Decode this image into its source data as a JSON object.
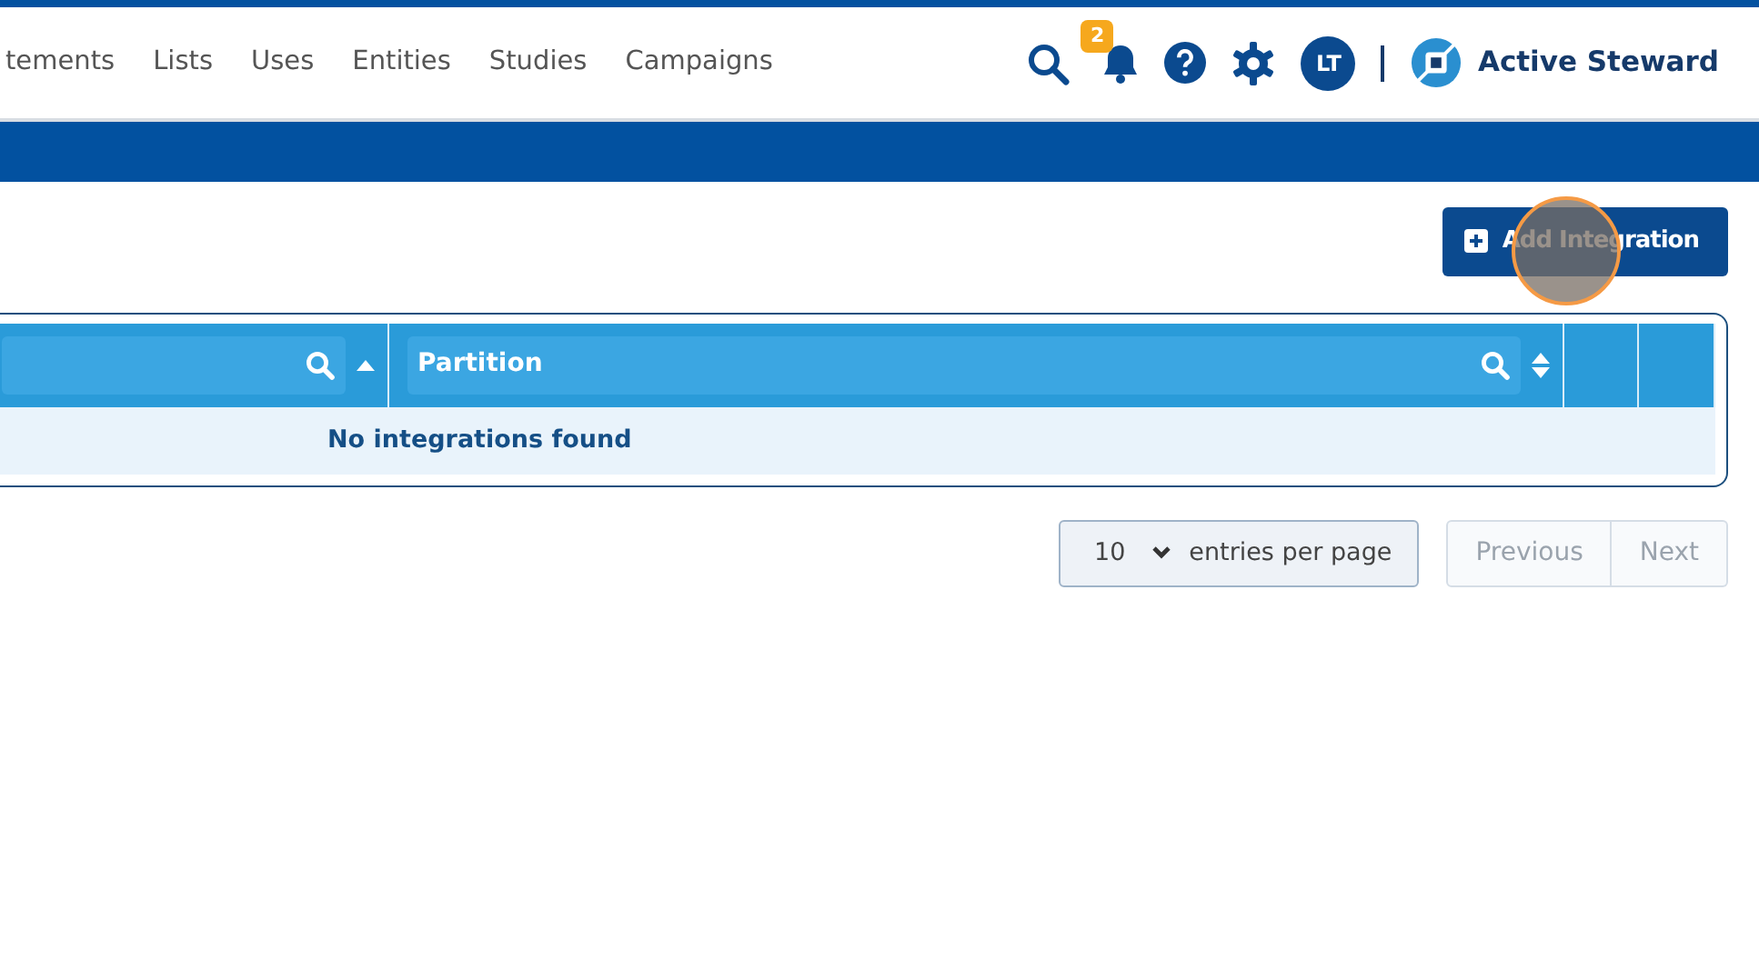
{
  "nav": {
    "items": [
      {
        "label": "tements"
      },
      {
        "label": "Lists"
      },
      {
        "label": "Uses"
      },
      {
        "label": "Entities"
      },
      {
        "label": "Studies"
      },
      {
        "label": "Campaigns"
      }
    ],
    "notification_count": "2",
    "avatar": "LT",
    "brand": "Active Steward"
  },
  "add_button": {
    "label": "Add Integration"
  },
  "table": {
    "columns": [
      {
        "kind": "filter",
        "sorted": true
      },
      {
        "kind": "filter",
        "label": "Partition",
        "sorted": false
      },
      {
        "kind": "blank"
      },
      {
        "kind": "blank"
      }
    ],
    "empty_message": "No integrations found"
  },
  "pager": {
    "page_size": "10",
    "entries_label": "entries per page",
    "buttons": [
      {
        "label": "Previous",
        "disabled": true
      },
      {
        "label": "Next",
        "disabled": true
      }
    ]
  }
}
